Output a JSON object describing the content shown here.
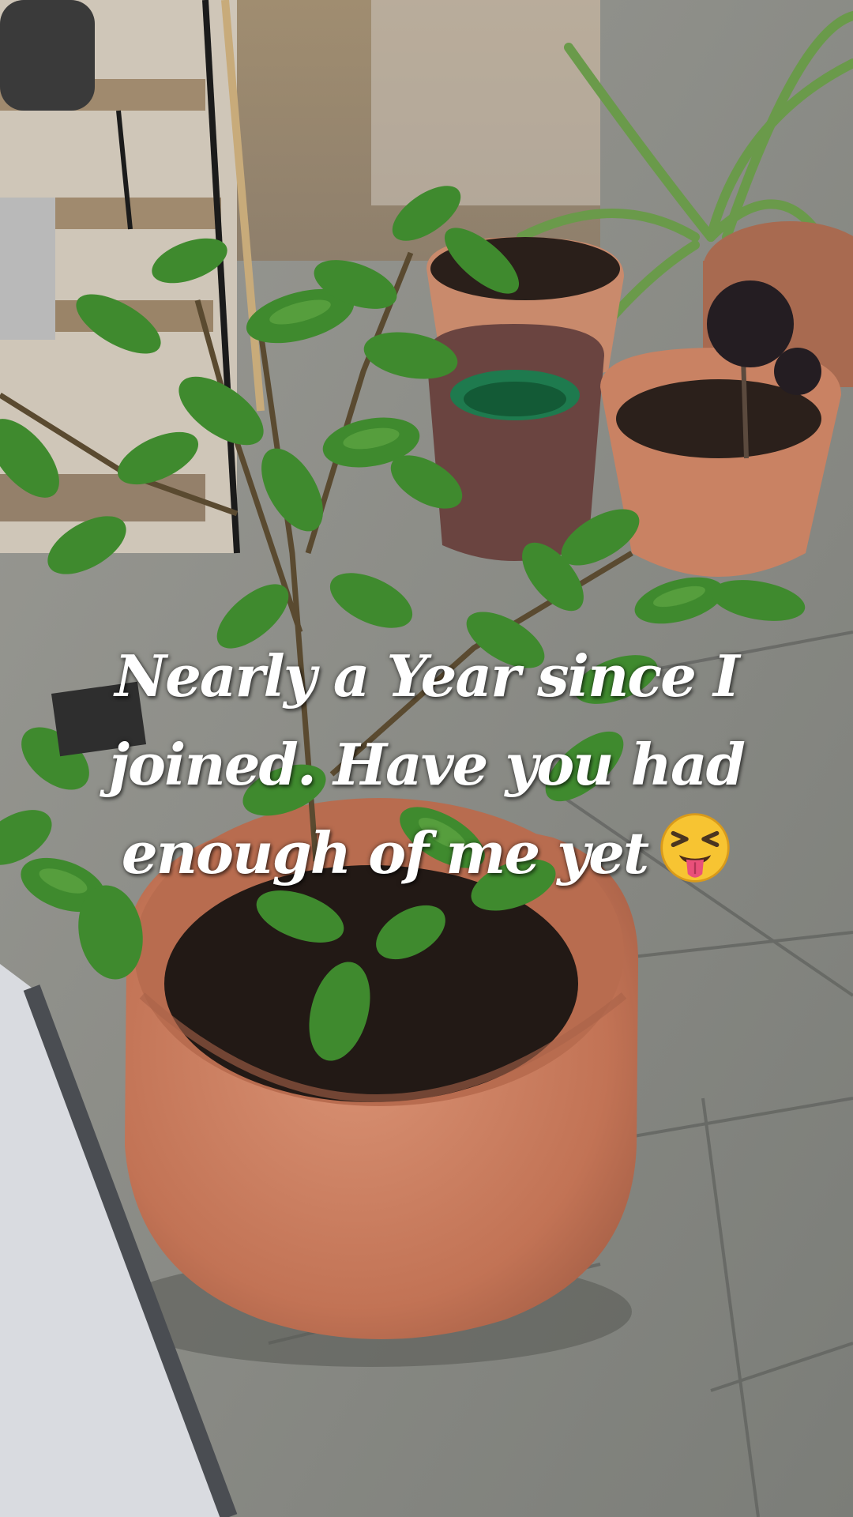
{
  "caption": {
    "line1": "Nearly a Year since I",
    "line2": "joined.  Have you had",
    "line3": "enough of me yet"
  },
  "emoji": "squinting-face-with-tongue-icon",
  "colors": {
    "caption_text": "#ffffff",
    "terracotta": "#c97a5c",
    "soil": "#231a16",
    "leaf": "#3f8a2e",
    "paving": "#8b8d88"
  }
}
